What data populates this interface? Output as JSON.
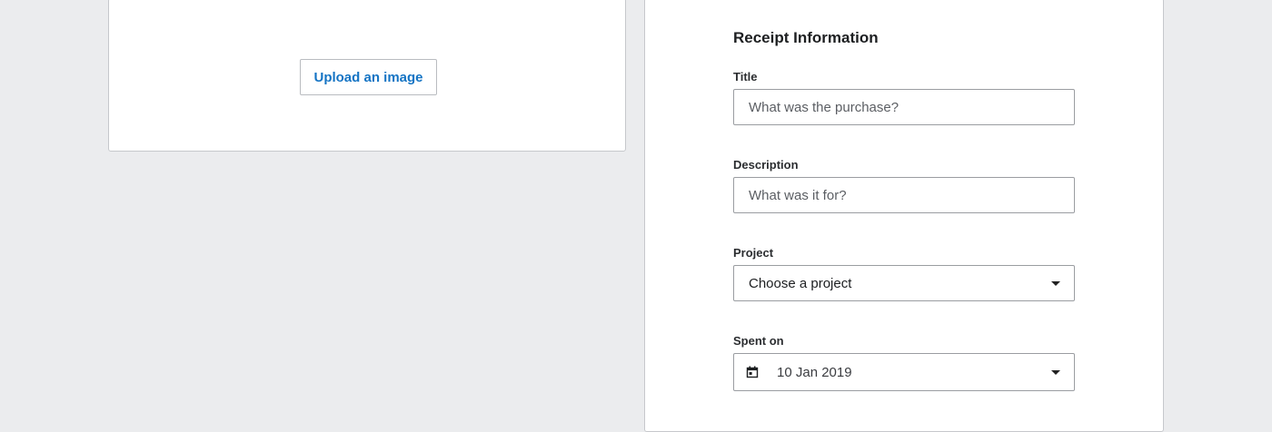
{
  "upload": {
    "button_label": "Upload an image"
  },
  "form": {
    "title": "Receipt Information",
    "title_field": {
      "label": "Title",
      "value": "",
      "placeholder": "What was the purchase?"
    },
    "description_field": {
      "label": "Description",
      "value": "",
      "placeholder": "What was it for?"
    },
    "project_field": {
      "label": "Project",
      "selected": "Choose a project",
      "icon": "chevron-down-icon"
    },
    "spent_on_field": {
      "label": "Spent on",
      "value": "10 Jan 2019",
      "icon": "calendar-icon"
    }
  },
  "colors": {
    "page_background": "#ebecee",
    "panel_background": "#ffffff",
    "accent_link": "#1574c4",
    "border": "#9a9da1"
  }
}
